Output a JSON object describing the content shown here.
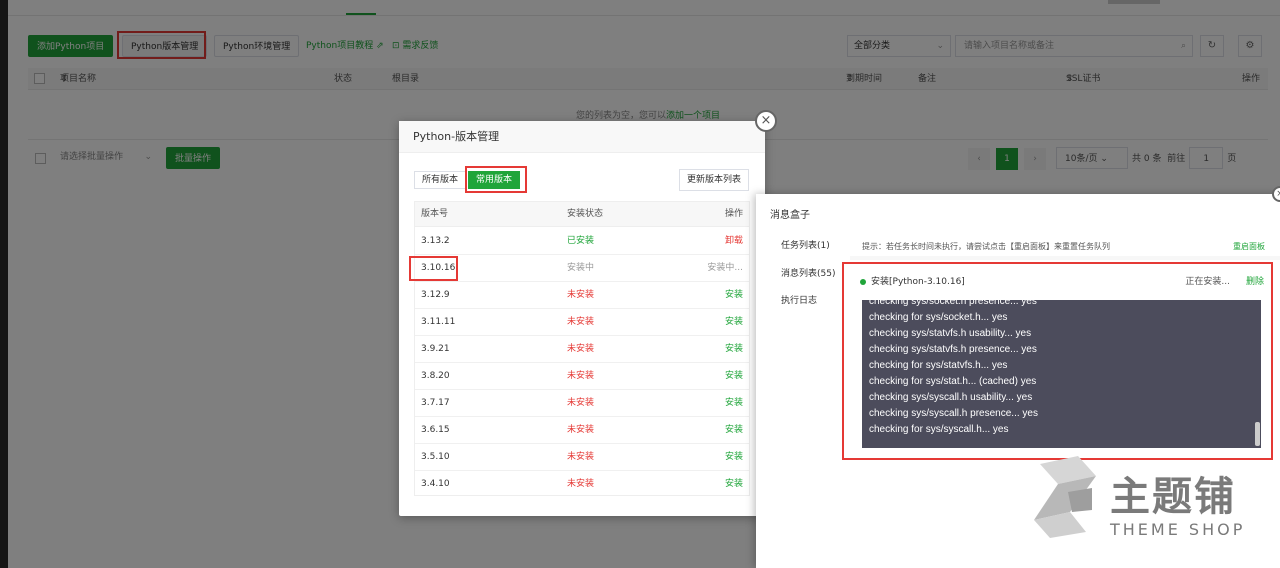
{
  "toolbar": {
    "add_project": "添加Python项目",
    "version_manage": "Python版本管理",
    "env_manage": "Python环境管理",
    "tutorial": "Python项目教程",
    "feedback": "需求反馈",
    "category_select": "全部分类",
    "search_placeholder": "请输入项目名称或备注"
  },
  "table": {
    "columns": [
      "项目名称",
      "状态",
      "根目录",
      "到期时间",
      "备注",
      "SSL证书",
      "操作"
    ],
    "empty_text": "您的列表为空，您可以",
    "empty_link": "添加一个项目",
    "batch_select": "请选择批量操作",
    "batch_button": "批量操作"
  },
  "pagination": {
    "current": "1",
    "per_page": "10条/页",
    "total": "共 0 条",
    "goto_label": "前往",
    "goto_value": "1",
    "page_suffix": "页"
  },
  "version_modal": {
    "title": "Python-版本管理",
    "tab_all": "所有版本",
    "tab_common": "常用版本",
    "update_button": "更新版本列表",
    "headers": {
      "version": "版本号",
      "status": "安装状态",
      "action": "操作"
    },
    "rows": [
      {
        "version": "3.13.2",
        "status": "已安装",
        "action": "卸载"
      },
      {
        "version": "3.10.16",
        "status": "安装中",
        "action": "安装中..."
      },
      {
        "version": "3.12.9",
        "status": "未安装",
        "action": "安装"
      },
      {
        "version": "3.11.11",
        "status": "未安装",
        "action": "安装"
      },
      {
        "version": "3.9.21",
        "status": "未安装",
        "action": "安装"
      },
      {
        "version": "3.8.20",
        "status": "未安装",
        "action": "安装"
      },
      {
        "version": "3.7.17",
        "status": "未安装",
        "action": "安装"
      },
      {
        "version": "3.6.15",
        "status": "未安装",
        "action": "安装"
      },
      {
        "version": "3.5.10",
        "status": "未安装",
        "action": "安装"
      },
      {
        "version": "3.4.10",
        "status": "未安装",
        "action": "安装"
      }
    ]
  },
  "message_box": {
    "title": "消息盒子",
    "sidebar": [
      "任务列表(1)",
      "消息列表(55)",
      "执行日志"
    ],
    "tip": "提示：若任务长时间未执行，请尝试点击【重启面板】来重置任务队列",
    "restart": "重启面板",
    "task_title": "安装[Python-3.10.16]",
    "task_status": "正在安装...",
    "task_delete": "删除",
    "log_lines": [
      "checking sys/socket.h presence... yes",
      "checking for sys/socket.h... yes",
      "checking sys/statvfs.h usability... yes",
      "checking sys/statvfs.h presence... yes",
      "checking for sys/statvfs.h... yes",
      "checking for sys/stat.h... (cached) yes",
      "checking sys/syscall.h usability... yes",
      "checking sys/syscall.h presence... yes",
      "checking for sys/syscall.h... yes"
    ]
  },
  "watermark": {
    "cn": "主题铺",
    "en": "THEME SHOP"
  },
  "colors": {
    "accent": "#20a53a",
    "danger": "#e53935",
    "highlight_box": "#e53935",
    "console_bg": "#4c4c5c"
  }
}
